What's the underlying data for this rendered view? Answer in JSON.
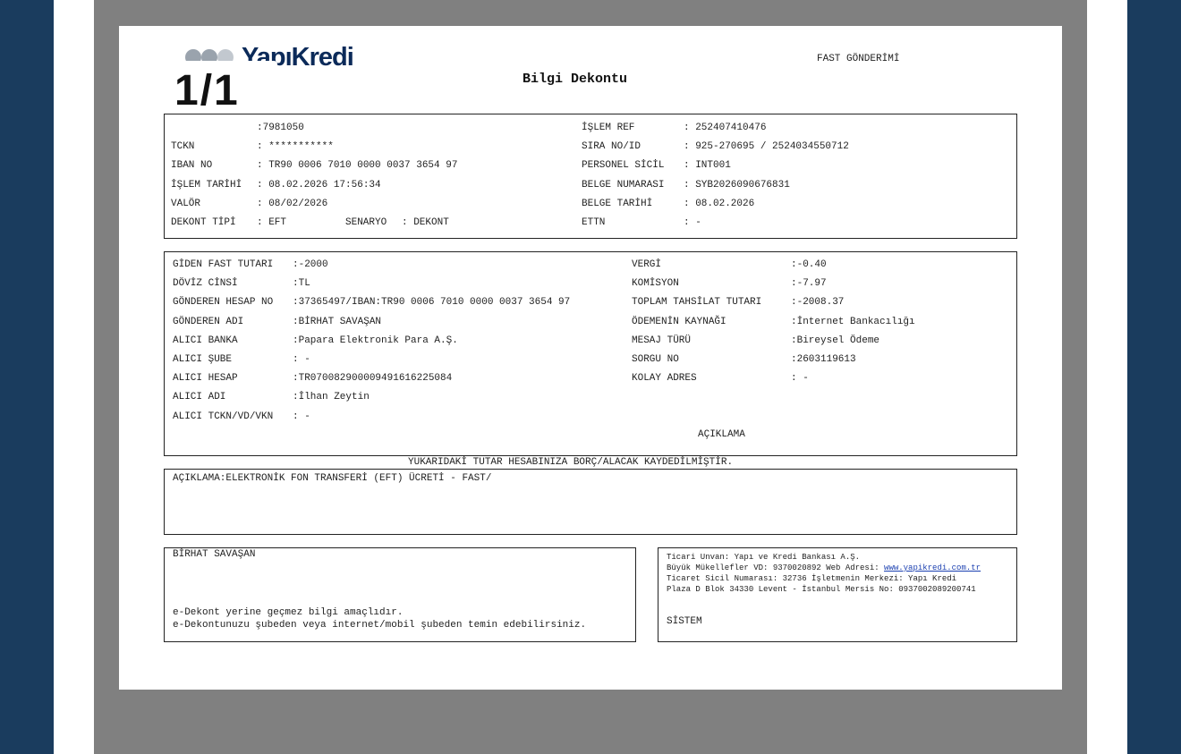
{
  "viewer": {
    "page_indicator": "1/1"
  },
  "header": {
    "logo_text": "YapıKredi",
    "title": "Bilgi Dekontu",
    "transfer_type": "FAST GÖNDERİMİ"
  },
  "info_left": [
    {
      "label": "",
      "value": ":7981050"
    },
    {
      "label": "TCKN        ",
      "value": ": ***********"
    },
    {
      "label": "IBAN NO     ",
      "value": ": TR90 0006 7010 0000 0037 3654 97"
    },
    {
      "label": "İŞLEM TARİHİ",
      "value": ": 08.02.2026 17:56:34"
    },
    {
      "label": "VALÖR       ",
      "value": ": 08/02/2026"
    },
    {
      "label": "DEKONT TİPİ ",
      "value": ": EFT"
    }
  ],
  "info_scenario": {
    "label": "SENARYO",
    "value": ": DEKONT"
  },
  "info_right": [
    {
      "label": "İŞLEM REF      ",
      "value": ": 252407410476"
    },
    {
      "label": "SIRA NO/ID     ",
      "value": ": 925-270695 / 2524034550712"
    },
    {
      "label": "PERSONEL SİCİL ",
      "value": ": INT001"
    },
    {
      "label": "BELGE NUMARASI ",
      "value": ": SYB2026090676831"
    },
    {
      "label": "BELGE TARİHİ   ",
      "value": ": 08.02.2026"
    },
    {
      "label": "ETTN           ",
      "value": ": -"
    }
  ],
  "detail_left": [
    {
      "label": "GİDEN FAST TUTARI ",
      "value": ":-2000"
    },
    {
      "label": "DÖVİZ CİNSİ       ",
      "value": ":TL"
    },
    {
      "label": "GÖNDEREN HESAP NO ",
      "value": ":37365497/IBAN:TR90 0006 7010 0000 0037 3654 97"
    },
    {
      "label": "GÖNDEREN ADI      ",
      "value": ":BİRHAT SAVAŞAN"
    },
    {
      "label": "ALICI BANKA       ",
      "value": ":Papara Elektronik Para A.Ş."
    },
    {
      "label": "ALICI ŞUBE        ",
      "value": ": -"
    },
    {
      "label": "ALICI HESAP       ",
      "value": ":TR070082900009491616225084"
    },
    {
      "label": "ALICI ADI         ",
      "value": ":İlhan Zeytin"
    },
    {
      "label": "ALICI TCKN/VD/VKN ",
      "value": ": -"
    }
  ],
  "detail_right": [
    {
      "label": "VERGİ                 ",
      "value": ":-0.40"
    },
    {
      "label": "KOMİSYON              ",
      "value": ":-7.97"
    },
    {
      "label": "TOPLAM TAHSİLAT TUTARI",
      "value": ":-2008.37"
    },
    {
      "label": "ÖDEMENİN KAYNAĞI      ",
      "value": ":İnternet Bankacılığı"
    },
    {
      "label": "MESAJ TÜRÜ            ",
      "value": ":Bireysel Ödeme"
    },
    {
      "label": "SORGU NO              ",
      "value": ":2603119613"
    },
    {
      "label": "KOLAY ADRES           ",
      "value": ": -"
    }
  ],
  "detail_note_heading": "AÇIKLAMA",
  "notice": "YUKARIDAKİ TUTAR HESABINIZA BORÇ/ALACAK KAYDEDİLMİŞTİR.",
  "description": "AÇIKLAMA:ELEKTRONİK FON TRANSFERİ (EFT) ÜCRETİ - FAST/",
  "customer": {
    "name": "BİRHAT SAVAŞAN",
    "note1": "e-Dekont yerine geçmez bilgi amaçlıdır.",
    "note2": "e-Dekontunuzu şubeden veya internet/mobil şubeden temin edebilirsiniz."
  },
  "bank": {
    "line1": "Ticari Unvan: Yapı ve Kredi Bankası A.Ş.",
    "line2_prefix": "Büyük Mükellefler VD: 9370020892 Web Adresi: ",
    "line2_link": "www.yapikredi.com.tr",
    "line3": "Ticaret Sicil Numarası: 32736 İşletmenin Merkezi: Yapı Kredi",
    "line4": "Plaza D Blok 34330 Levent - İstanbul Mersis No: 0937002089200741",
    "signature": "SİSTEM"
  },
  "colors": {
    "background": "#1a3c5e",
    "viewer": "#808080",
    "logo": "#0b2a59"
  }
}
